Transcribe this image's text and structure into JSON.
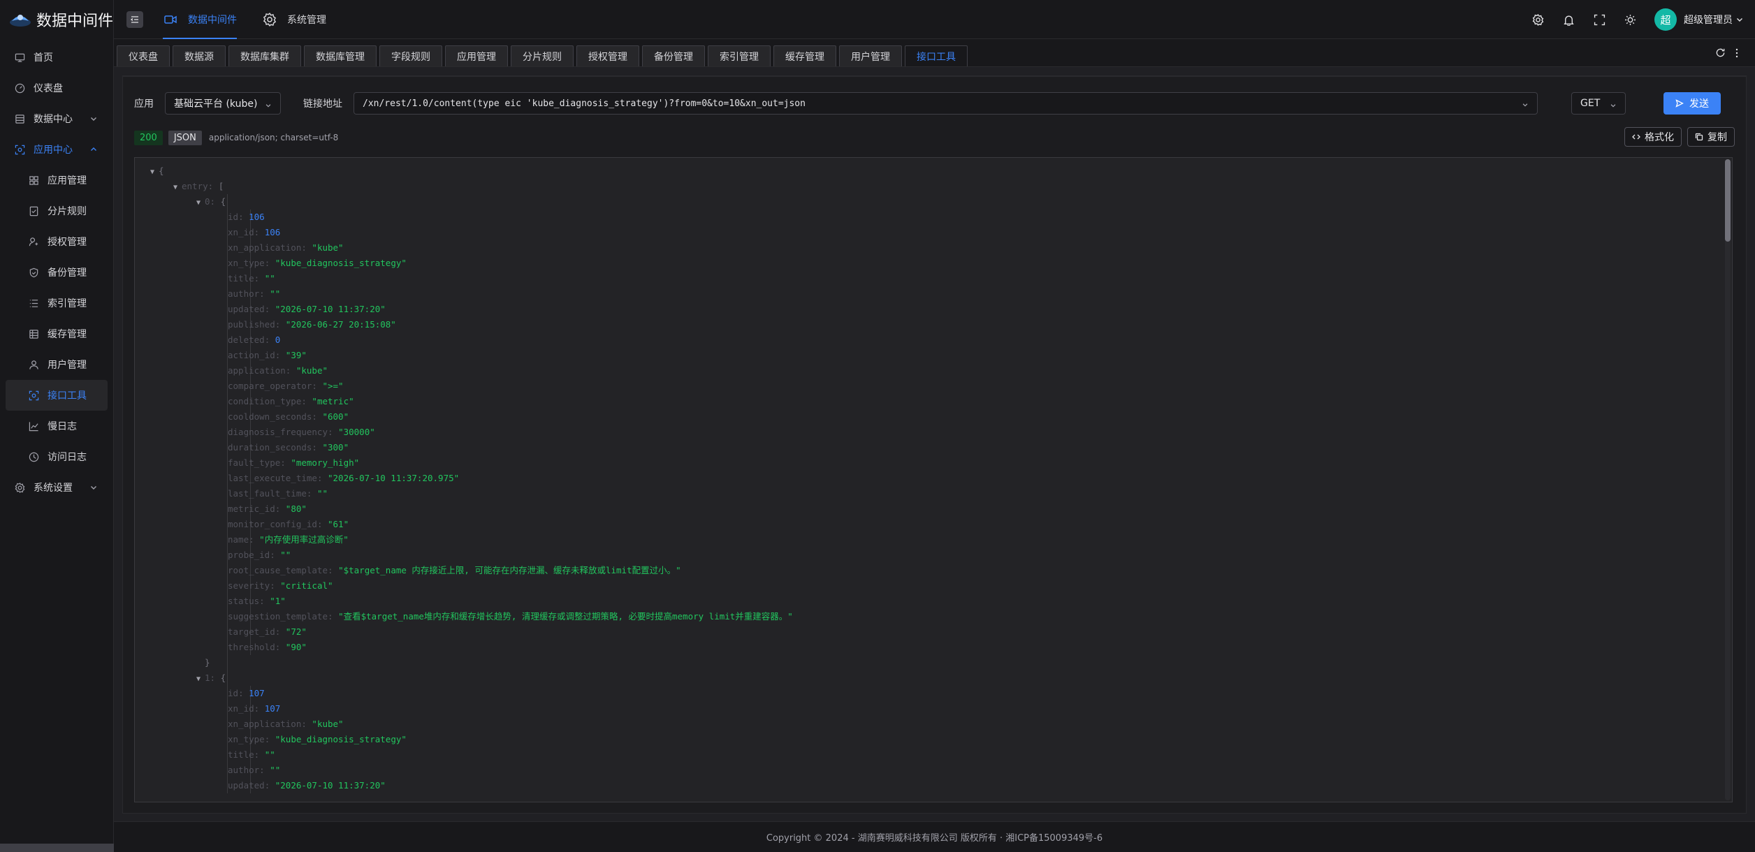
{
  "app": {
    "title": "数据中间件"
  },
  "sidebar": {
    "items": [
      {
        "label": "首页",
        "icon": "monitor-icon"
      },
      {
        "label": "仪表盘",
        "icon": "dashboard-icon"
      },
      {
        "label": "数据中心",
        "icon": "database-icon",
        "expandable": true
      },
      {
        "label": "应用中心",
        "icon": "app-center-icon",
        "expandable": true,
        "expanded": true
      }
    ],
    "app_center_children": [
      {
        "label": "应用管理",
        "icon": "grid-icon"
      },
      {
        "label": "分片规则",
        "icon": "shard-icon"
      },
      {
        "label": "授权管理",
        "icon": "user-key-icon"
      },
      {
        "label": "备份管理",
        "icon": "shield-icon"
      },
      {
        "label": "索引管理",
        "icon": "list-icon"
      },
      {
        "label": "缓存管理",
        "icon": "cache-icon"
      },
      {
        "label": "用户管理",
        "icon": "user-icon"
      },
      {
        "label": "接口工具",
        "icon": "api-tool-icon",
        "active": true
      },
      {
        "label": "慢日志",
        "icon": "chart-line-icon"
      },
      {
        "label": "访问日志",
        "icon": "history-icon"
      }
    ],
    "settings": {
      "label": "系统设置",
      "icon": "settings-icon"
    }
  },
  "header": {
    "nav": [
      {
        "label": "数据中间件",
        "active": true
      },
      {
        "label": "系统管理",
        "active": false
      }
    ],
    "user": {
      "avatar_text": "超",
      "name": "超级管理员"
    }
  },
  "tabs": [
    "仪表盘",
    "数据源",
    "数据库集群",
    "数据库管理",
    "字段规则",
    "应用管理",
    "分片规则",
    "授权管理",
    "备份管理",
    "索引管理",
    "缓存管理",
    "用户管理",
    "接口工具"
  ],
  "active_tab": "接口工具",
  "request": {
    "app_label": "应用",
    "app_value": "基础云平台 (kube)",
    "url_label": "链接地址",
    "url_value": "/xn/rest/1.0/content(type eic 'kube_diagnosis_strategy')?from=0&to=10&xn_out=json",
    "method": "GET",
    "send_label": "发送"
  },
  "response": {
    "status": "200",
    "type": "JSON",
    "content_type": "application/json; charset=utf-8",
    "format_label": "格式化",
    "copy_label": "复制"
  },
  "json_lines": [
    {
      "indent": 0,
      "tri": true,
      "parts": [
        [
          "p",
          "{"
        ]
      ]
    },
    {
      "indent": 1,
      "tri": true,
      "parts": [
        [
          "k",
          "entry"
        ],
        [
          "k",
          ": "
        ],
        [
          "p",
          "["
        ]
      ]
    },
    {
      "indent": 2,
      "tri": true,
      "parts": [
        [
          "k",
          "0"
        ],
        [
          "k",
          ": "
        ],
        [
          "p",
          "{"
        ]
      ]
    },
    {
      "indent": 3,
      "parts": [
        [
          "k",
          "id"
        ],
        [
          "k",
          ": "
        ],
        [
          "n",
          "106"
        ]
      ]
    },
    {
      "indent": 3,
      "parts": [
        [
          "k",
          "xn_id"
        ],
        [
          "k",
          ": "
        ],
        [
          "n",
          "106"
        ]
      ]
    },
    {
      "indent": 3,
      "parts": [
        [
          "k",
          "xn_application"
        ],
        [
          "k",
          ": "
        ],
        [
          "s",
          "\"kube\""
        ]
      ]
    },
    {
      "indent": 3,
      "parts": [
        [
          "k",
          "xn_type"
        ],
        [
          "k",
          ": "
        ],
        [
          "s",
          "\"kube_diagnosis_strategy\""
        ]
      ]
    },
    {
      "indent": 3,
      "parts": [
        [
          "k",
          "title"
        ],
        [
          "k",
          ": "
        ],
        [
          "s",
          "\"\""
        ]
      ]
    },
    {
      "indent": 3,
      "parts": [
        [
          "k",
          "author"
        ],
        [
          "k",
          ": "
        ],
        [
          "s",
          "\"\""
        ]
      ]
    },
    {
      "indent": 3,
      "parts": [
        [
          "k",
          "updated"
        ],
        [
          "k",
          ": "
        ],
        [
          "s",
          "\"2026-07-10 11:37:20\""
        ]
      ]
    },
    {
      "indent": 3,
      "parts": [
        [
          "k",
          "published"
        ],
        [
          "k",
          ": "
        ],
        [
          "s",
          "\"2026-06-27 20:15:08\""
        ]
      ]
    },
    {
      "indent": 3,
      "parts": [
        [
          "k",
          "deleted"
        ],
        [
          "k",
          ": "
        ],
        [
          "n",
          "0"
        ]
      ]
    },
    {
      "indent": 3,
      "parts": [
        [
          "k",
          "action_id"
        ],
        [
          "k",
          ": "
        ],
        [
          "s",
          "\"39\""
        ]
      ]
    },
    {
      "indent": 3,
      "parts": [
        [
          "k",
          "application"
        ],
        [
          "k",
          ": "
        ],
        [
          "s",
          "\"kube\""
        ]
      ]
    },
    {
      "indent": 3,
      "parts": [
        [
          "k",
          "compare_operator"
        ],
        [
          "k",
          ": "
        ],
        [
          "s",
          "\">=\""
        ]
      ]
    },
    {
      "indent": 3,
      "parts": [
        [
          "k",
          "condition_type"
        ],
        [
          "k",
          ": "
        ],
        [
          "s",
          "\"metric\""
        ]
      ]
    },
    {
      "indent": 3,
      "parts": [
        [
          "k",
          "cooldown_seconds"
        ],
        [
          "k",
          ": "
        ],
        [
          "s",
          "\"600\""
        ]
      ]
    },
    {
      "indent": 3,
      "parts": [
        [
          "k",
          "diagnosis_frequency"
        ],
        [
          "k",
          ": "
        ],
        [
          "s",
          "\"30000\""
        ]
      ]
    },
    {
      "indent": 3,
      "parts": [
        [
          "k",
          "duration_seconds"
        ],
        [
          "k",
          ": "
        ],
        [
          "s",
          "\"300\""
        ]
      ]
    },
    {
      "indent": 3,
      "parts": [
        [
          "k",
          "fault_type"
        ],
        [
          "k",
          ": "
        ],
        [
          "s",
          "\"memory_high\""
        ]
      ]
    },
    {
      "indent": 3,
      "parts": [
        [
          "k",
          "last_execute_time"
        ],
        [
          "k",
          ": "
        ],
        [
          "s",
          "\"2026-07-10 11:37:20.975\""
        ]
      ]
    },
    {
      "indent": 3,
      "parts": [
        [
          "k",
          "last_fault_time"
        ],
        [
          "k",
          ": "
        ],
        [
          "s",
          "\"\""
        ]
      ]
    },
    {
      "indent": 3,
      "parts": [
        [
          "k",
          "metric_id"
        ],
        [
          "k",
          ": "
        ],
        [
          "s",
          "\"80\""
        ]
      ]
    },
    {
      "indent": 3,
      "parts": [
        [
          "k",
          "monitor_config_id"
        ],
        [
          "k",
          ": "
        ],
        [
          "s",
          "\"61\""
        ]
      ]
    },
    {
      "indent": 3,
      "parts": [
        [
          "k",
          "name"
        ],
        [
          "k",
          ": "
        ],
        [
          "s",
          "\"内存使用率过高诊断\""
        ]
      ]
    },
    {
      "indent": 3,
      "parts": [
        [
          "k",
          "probe_id"
        ],
        [
          "k",
          ": "
        ],
        [
          "s",
          "\"\""
        ]
      ]
    },
    {
      "indent": 3,
      "parts": [
        [
          "k",
          "root_cause_template"
        ],
        [
          "k",
          ": "
        ],
        [
          "s",
          "\"$target_name 内存接近上限, 可能存在内存泄漏、缓存未释放或limit配置过小。\""
        ]
      ]
    },
    {
      "indent": 3,
      "parts": [
        [
          "k",
          "severity"
        ],
        [
          "k",
          ": "
        ],
        [
          "s",
          "\"critical\""
        ]
      ]
    },
    {
      "indent": 3,
      "parts": [
        [
          "k",
          "status"
        ],
        [
          "k",
          ": "
        ],
        [
          "s",
          "\"1\""
        ]
      ]
    },
    {
      "indent": 3,
      "parts": [
        [
          "k",
          "suggestion_template"
        ],
        [
          "k",
          ": "
        ],
        [
          "s",
          "\"查看$target_name堆内存和缓存增长趋势, 清理缓存或调整过期策略, 必要时提高memory limit并重建容器。\""
        ]
      ]
    },
    {
      "indent": 3,
      "parts": [
        [
          "k",
          "target_id"
        ],
        [
          "k",
          ": "
        ],
        [
          "s",
          "\"72\""
        ]
      ]
    },
    {
      "indent": 3,
      "parts": [
        [
          "k",
          "threshold"
        ],
        [
          "k",
          ": "
        ],
        [
          "s",
          "\"90\""
        ]
      ]
    },
    {
      "indent": 2,
      "parts": [
        [
          "p",
          "}"
        ]
      ]
    },
    {
      "indent": 2,
      "tri": true,
      "parts": [
        [
          "k",
          "1"
        ],
        [
          "k",
          ": "
        ],
        [
          "p",
          "{"
        ]
      ]
    },
    {
      "indent": 3,
      "parts": [
        [
          "k",
          "id"
        ],
        [
          "k",
          ": "
        ],
        [
          "n",
          "107"
        ]
      ]
    },
    {
      "indent": 3,
      "parts": [
        [
          "k",
          "xn_id"
        ],
        [
          "k",
          ": "
        ],
        [
          "n",
          "107"
        ]
      ]
    },
    {
      "indent": 3,
      "parts": [
        [
          "k",
          "xn_application"
        ],
        [
          "k",
          ": "
        ],
        [
          "s",
          "\"kube\""
        ]
      ]
    },
    {
      "indent": 3,
      "parts": [
        [
          "k",
          "xn_type"
        ],
        [
          "k",
          ": "
        ],
        [
          "s",
          "\"kube_diagnosis_strategy\""
        ]
      ]
    },
    {
      "indent": 3,
      "parts": [
        [
          "k",
          "title"
        ],
        [
          "k",
          ": "
        ],
        [
          "s",
          "\"\""
        ]
      ]
    },
    {
      "indent": 3,
      "parts": [
        [
          "k",
          "author"
        ],
        [
          "k",
          ": "
        ],
        [
          "s",
          "\"\""
        ]
      ]
    },
    {
      "indent": 3,
      "parts": [
        [
          "k",
          "updated"
        ],
        [
          "k",
          ": "
        ],
        [
          "s",
          "\"2026-07-10 11:37:20\""
        ]
      ]
    }
  ],
  "footer": {
    "copyright": "Copyright © 2024 - 湖南赛明威科技有限公司 版权所有 · 湘ICP备15009349号-6"
  },
  "colors": {
    "accent": "#3b82f6",
    "success": "#22c55e",
    "avatar": "#14b8a6"
  }
}
